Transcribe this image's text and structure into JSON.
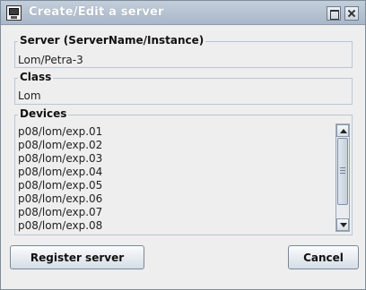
{
  "window": {
    "title": "Create/Edit a server"
  },
  "server": {
    "legend": "Server  (ServerName/Instance)",
    "value": "Lom/Petra-3"
  },
  "class_group": {
    "legend": "Class",
    "value": "Lom"
  },
  "devices": {
    "legend": "Devices",
    "items": [
      "p08/lom/exp.01",
      "p08/lom/exp.02",
      "p08/lom/exp.03",
      "p08/lom/exp.04",
      "p08/lom/exp.05",
      "p08/lom/exp.06",
      "p08/lom/exp.07",
      "p08/lom/exp.08"
    ]
  },
  "buttons": {
    "register": "Register server",
    "cancel": "Cancel"
  },
  "icons": {
    "app": "monitor-icon",
    "maximize": "maximize-icon",
    "close": "close-icon",
    "scroll_up": "arrow-up-icon",
    "scroll_down": "arrow-down-icon"
  }
}
